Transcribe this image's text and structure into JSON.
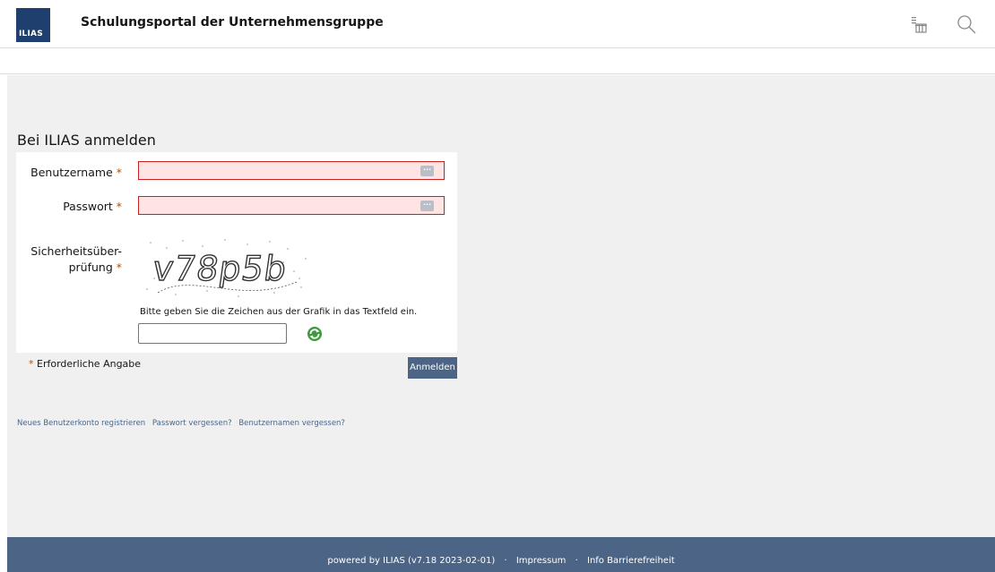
{
  "header": {
    "logo_text": "ILIAS",
    "title": "Schulungsportal der Unternehmensgruppe",
    "icons": [
      "tools-icon",
      "search-icon"
    ]
  },
  "login": {
    "heading": "Bei ILIAS anmelden",
    "username_label": "Benutzername",
    "password_label": "Passwort",
    "captcha_label_line1": "Sicherheitsüber-",
    "captcha_label_line2": "prüfung",
    "required_marker": "*",
    "captcha_text": "v78p5b",
    "captcha_hint": "Bitte geben Sie die Zeichen aus der Grafik in das Textfeld ein.",
    "required_note": "Erforderliche Angabe",
    "submit_label": "Anmelden"
  },
  "links": [
    "Neues Benutzerkonto registrieren",
    "Passwort vergessen?",
    "Benutzernamen vergessen?"
  ],
  "footer": {
    "powered": "powered by ILIAS (v7.18 2023-02-01)",
    "imprint": "Impressum",
    "accessibility": "Info Barrierefreiheit",
    "separator": "·"
  },
  "colors": {
    "brand": "#4c6586",
    "logo_bg": "#1f3f6e",
    "error_border": "#cc1f1f",
    "error_bg": "#ffe4e4",
    "required": "#b54f00"
  }
}
